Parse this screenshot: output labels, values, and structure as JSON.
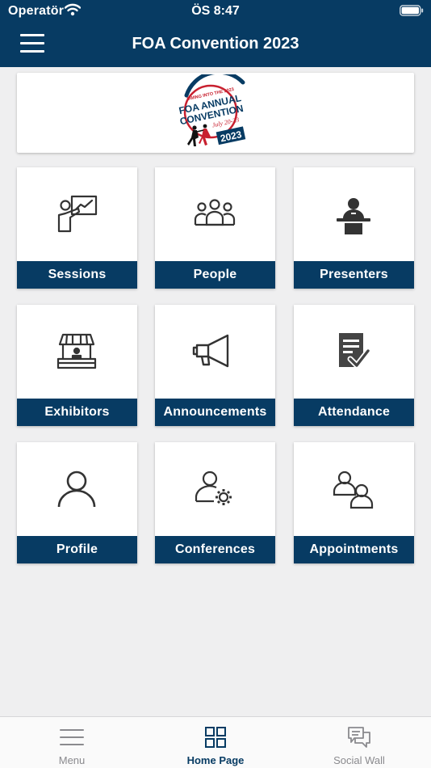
{
  "status_bar": {
    "carrier": "Operatör",
    "time": "ÖS 8:47"
  },
  "header": {
    "title": "FOA Convention 2023"
  },
  "banner": {
    "logo_text": {
      "tagline": "SWING INTO THE 2023",
      "line1": "FOA ANNUAL",
      "line2": "CONVENTION",
      "dates": "July 20-23",
      "year": "2023"
    }
  },
  "tiles": [
    {
      "label": "Sessions",
      "icon": "presentation-board-icon"
    },
    {
      "label": "People",
      "icon": "people-group-icon"
    },
    {
      "label": "Presenters",
      "icon": "presenter-podium-icon"
    },
    {
      "label": "Exhibitors",
      "icon": "exhibitor-booth-icon"
    },
    {
      "label": "Announcements",
      "icon": "megaphone-icon"
    },
    {
      "label": "Attendance",
      "icon": "checklist-icon"
    },
    {
      "label": "Profile",
      "icon": "person-icon"
    },
    {
      "label": "Conferences",
      "icon": "person-gear-icon"
    },
    {
      "label": "Appointments",
      "icon": "two-people-icon"
    }
  ],
  "tabbar": {
    "items": [
      {
        "label": "Menu",
        "icon": "menu-lines-icon",
        "active": false
      },
      {
        "label": "Home Page",
        "icon": "grid-icon",
        "active": true
      },
      {
        "label": "Social Wall",
        "icon": "chat-bubbles-icon",
        "active": false
      }
    ]
  },
  "colors": {
    "brand": "#073b63",
    "background": "#efeff0",
    "accent_red": "#c8202f"
  }
}
